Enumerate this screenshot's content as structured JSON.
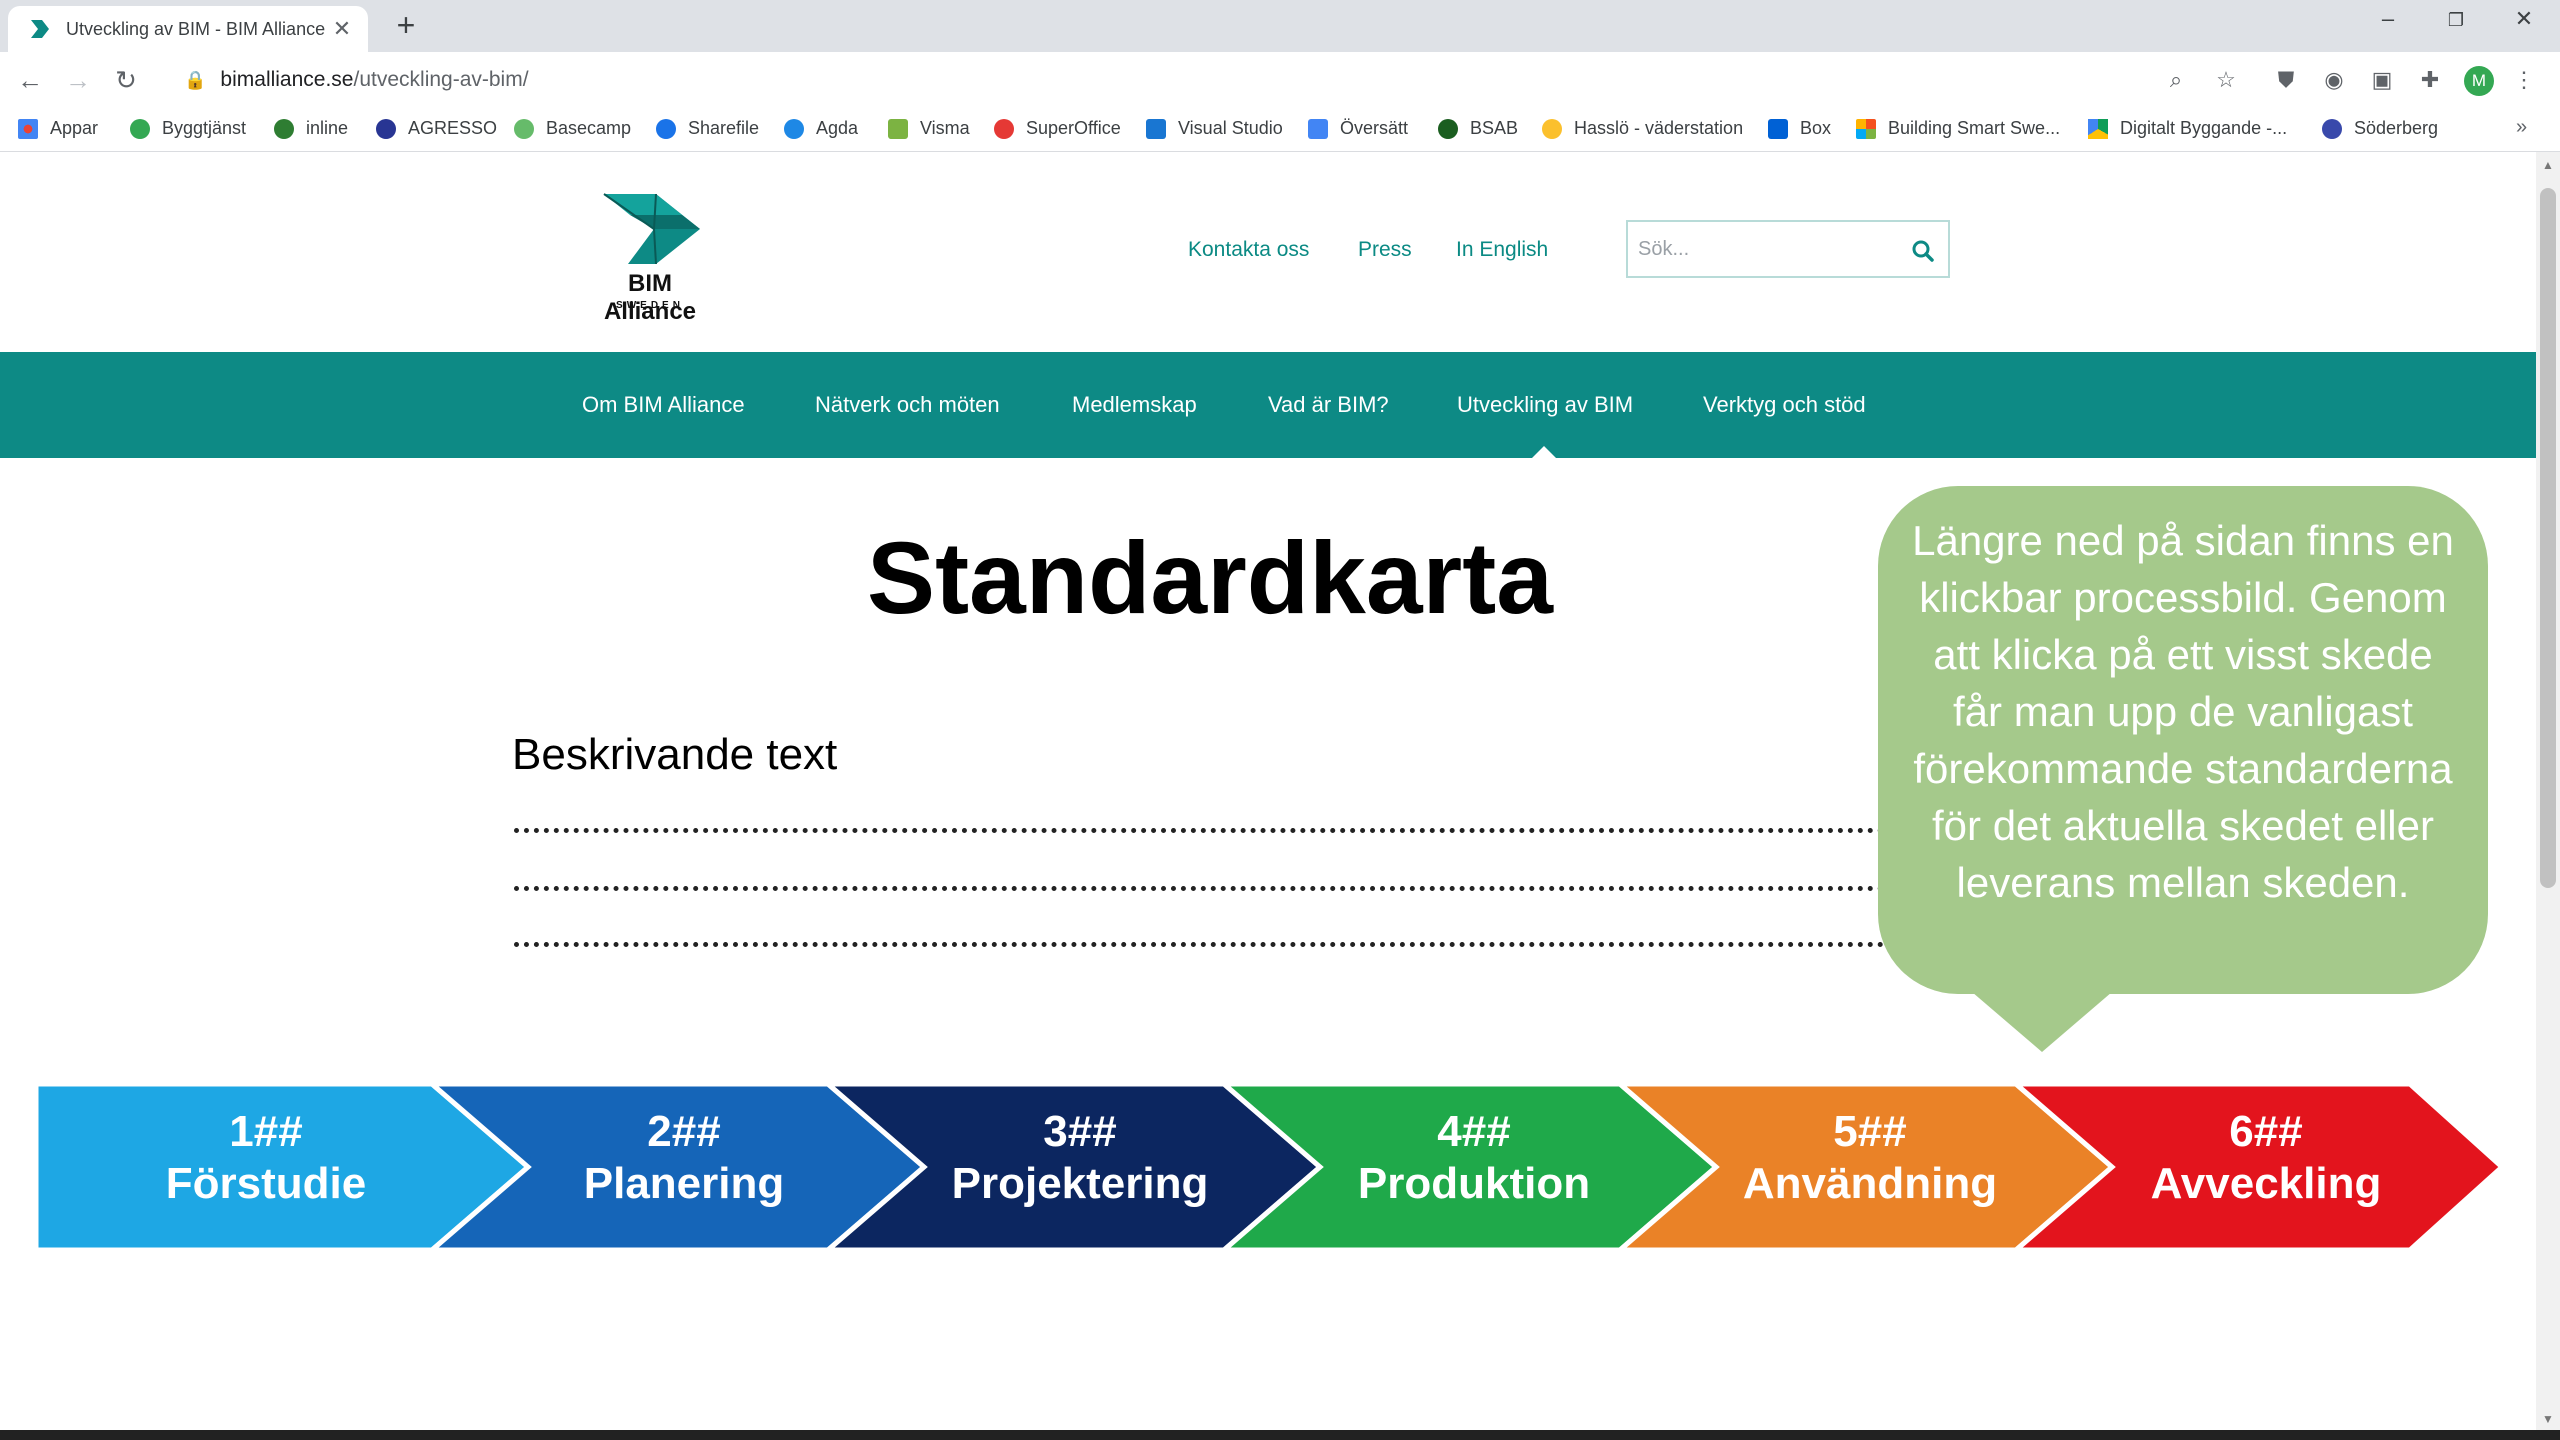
{
  "browser": {
    "tab_title": "Utveckling av BIM - BIM Alliance",
    "url_host": "bimalliance.se",
    "url_path": "/utveckling-av-bim/",
    "profile_initial": "M",
    "bookmarks": [
      {
        "label": "Appar",
        "color": "#ea4335"
      },
      {
        "label": "Byggtjänst",
        "color": "#34a853"
      },
      {
        "label": "inline",
        "color": "#2e7d32"
      },
      {
        "label": "AGRESSO",
        "color": "#283593"
      },
      {
        "label": "Basecamp",
        "color": "#66bb6a"
      },
      {
        "label": "Sharefile",
        "color": "#1a73e8"
      },
      {
        "label": "Agda",
        "color": "#1e88e5"
      },
      {
        "label": "Visma",
        "color": "#7cb342"
      },
      {
        "label": "SuperOffice",
        "color": "#e53935"
      },
      {
        "label": "Visual Studio",
        "color": "#1976d2"
      },
      {
        "label": "Översätt",
        "color": "#4285f4"
      },
      {
        "label": "BSAB",
        "color": "#1b5e20"
      },
      {
        "label": "Hasslö - väderstation",
        "color": "#fbc02d"
      },
      {
        "label": "Box",
        "color": "#0061d5"
      },
      {
        "label": "Building Smart Swe...",
        "color": "#f4511e"
      },
      {
        "label": "Digitalt Byggande -...",
        "color": "#0f9d58"
      },
      {
        "label": "Söderberg",
        "color": "#3949ab"
      }
    ]
  },
  "site": {
    "logo_name": "BIM Alliance",
    "logo_sub": "SWEDEN",
    "top_links": [
      "Kontakta oss",
      "Press",
      "In English"
    ],
    "search_placeholder": "Sök...",
    "nav": [
      "Om BIM Alliance",
      "Nätverk och möten",
      "Medlemskap",
      "Vad är BIM?",
      "Utveckling av BIM",
      "Verktyg och stöd"
    ],
    "active_nav": "Utveckling av BIM",
    "brand_color": "#0d8a85"
  },
  "content": {
    "heading": "Standardkarta",
    "description_label": "Beskrivande text",
    "callout": "Längre ned på sidan finns en klickbar processbild. Genom att klicka på ett visst skede får man upp de vanligast förekommande standarderna för det aktuella skedet eller leverans   mellan skeden.",
    "stages": [
      {
        "code": "1##",
        "name": "Förstudie",
        "color": "#1ea7e4"
      },
      {
        "code": "2##",
        "name": "Planering",
        "color": "#1565b8"
      },
      {
        "code": "3##",
        "name": "Projektering",
        "color": "#0c2660"
      },
      {
        "code": "4##",
        "name": "Produktion",
        "color": "#1fa94a"
      },
      {
        "code": "5##",
        "name": "Användning",
        "color": "#ea8227"
      },
      {
        "code": "6##",
        "name": "Avveckling",
        "color": "#e3141d"
      }
    ]
  }
}
